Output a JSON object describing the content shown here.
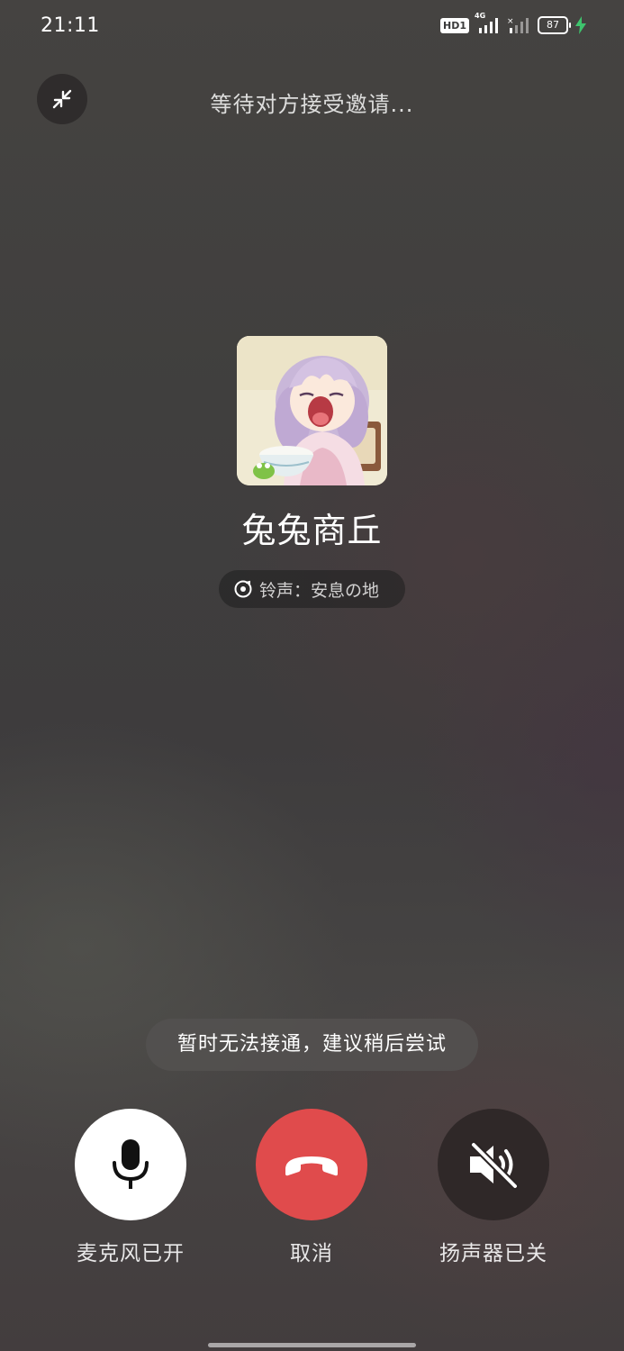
{
  "status_bar": {
    "time": "21:11",
    "hd_label": "HD1",
    "network_label": "4G",
    "battery_level": "87",
    "charging": true,
    "charging_color": "#3ec46d"
  },
  "header": {
    "status_text": "等待对方接受邀请...",
    "minimize_icon": "collapse-arrows-icon"
  },
  "contact": {
    "name": "兔兔商丘",
    "avatar_icon": "anime-girl-avatar",
    "ringtone_icon": "music-disc-icon",
    "ringtone_text": "铃声：安息の地"
  },
  "toast": {
    "message": "暂时无法接通，建议稍后尝试"
  },
  "controls": {
    "mic": {
      "label": "麦克风已开",
      "icon": "microphone-icon",
      "state": "on"
    },
    "cancel": {
      "label": "取消",
      "icon": "hang-up-icon",
      "color": "#e04b4c"
    },
    "speaker": {
      "label": "扬声器已关",
      "icon": "speaker-muted-icon",
      "state": "off"
    }
  }
}
